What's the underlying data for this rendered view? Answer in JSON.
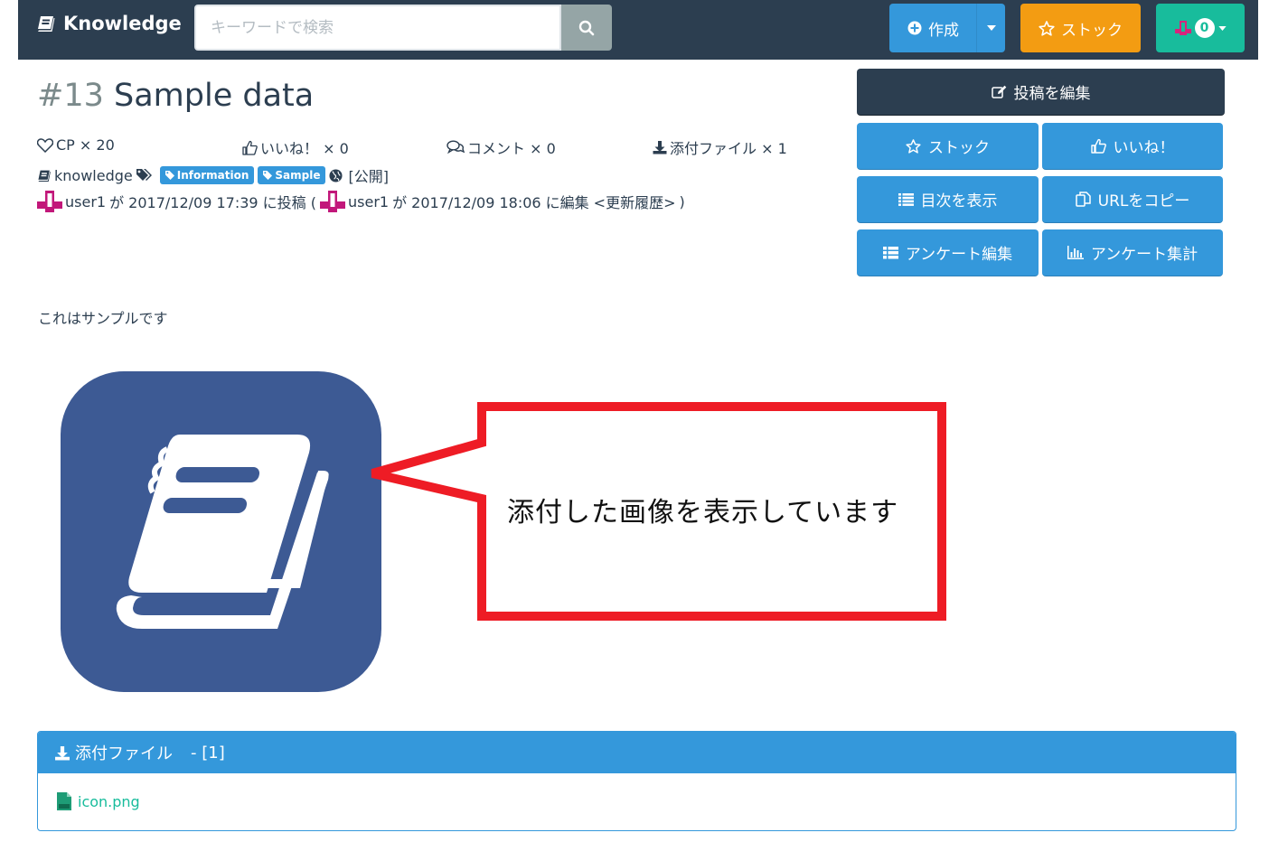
{
  "navbar": {
    "brand": "Knowledge",
    "search_placeholder": "キーワードで検索",
    "create_label": "作成",
    "stock_label": "ストック",
    "notification_count": "0"
  },
  "article": {
    "number": "#13",
    "title": "Sample data",
    "stats": {
      "cp": "CP × 20",
      "likes": "いいね！ × 0",
      "comments": "コメント × 0",
      "attachments": "添付ファイル × 1"
    },
    "group": "knowledge",
    "tags": [
      "Information",
      "Sample"
    ],
    "visibility": "[公開]",
    "post_info": {
      "creator": "user1",
      "created_text": "が 2017/12/09 17:39 に投稿 (",
      "editor": "user1",
      "edited_text": "が 2017/12/09 18:06 に編集",
      "history_link": "<更新履歴>",
      "close_paren": ")"
    },
    "body_text": "これはサンプルです",
    "callout_text": "添付した画像を表示しています"
  },
  "actions": {
    "edit": "投稿を編集",
    "stock": "ストック",
    "like": "いいね！",
    "toc": "目次を表示",
    "copy_url": "URLをコピー",
    "survey_edit": "アンケート編集",
    "survey_result": "アンケート集計"
  },
  "attachments": {
    "heading": "添付ファイル",
    "count": "- [1]",
    "files": [
      "icon.png"
    ]
  },
  "colors": {
    "navbar": "#2c3e50",
    "primary": "#3498db",
    "warning": "#f39c12",
    "success": "#18bc9c",
    "icon_bg": "#3d5a94",
    "callout_border": "#ee1c25"
  }
}
